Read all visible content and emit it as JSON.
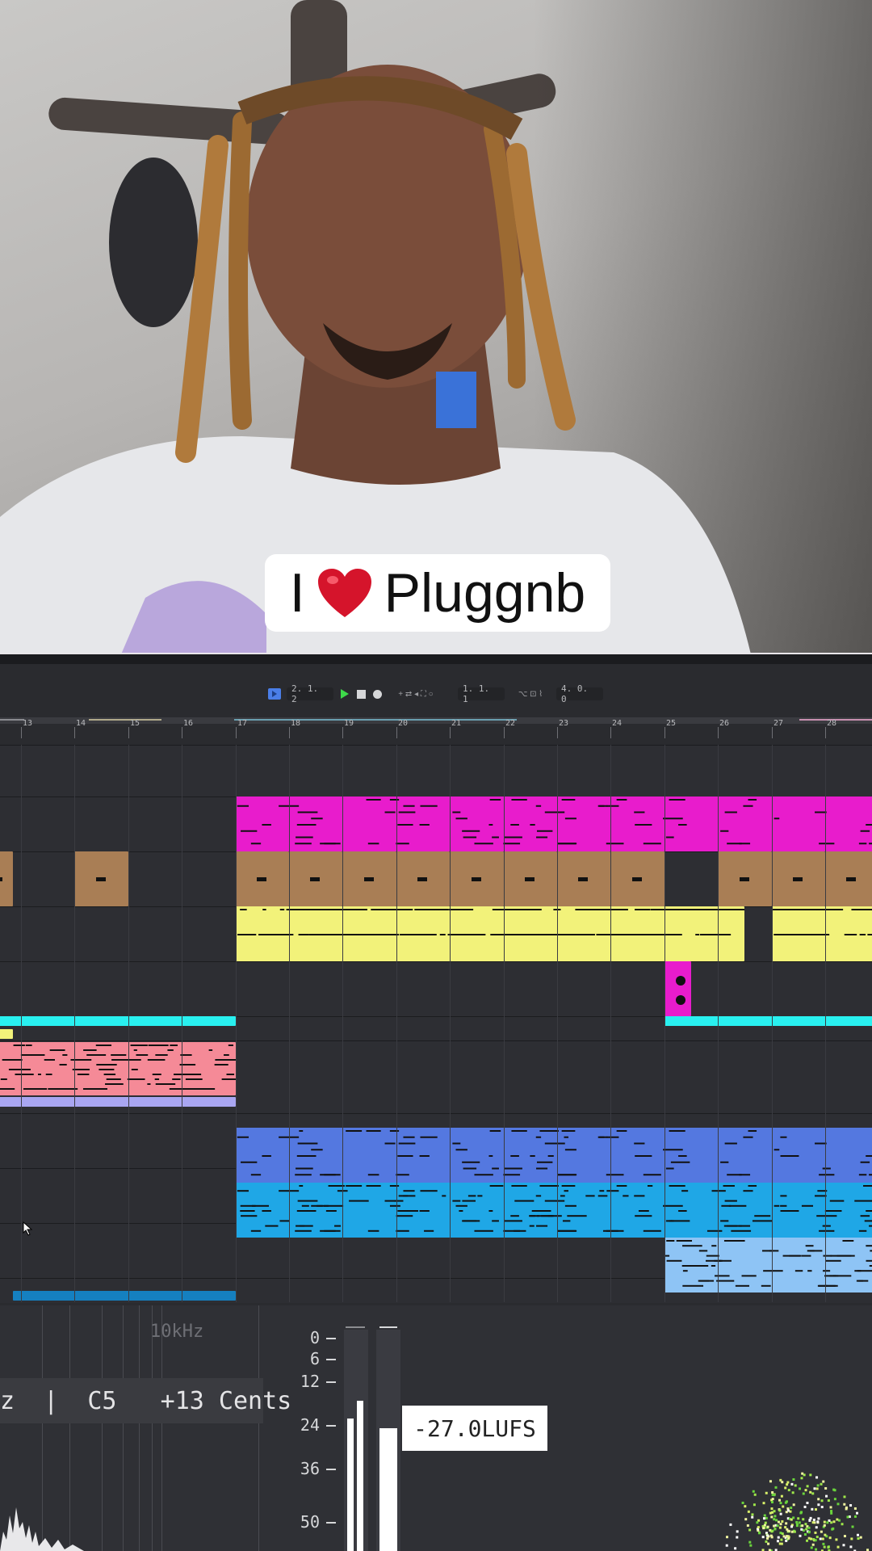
{
  "caption": {
    "text_before": "I",
    "heart_icon": "red-heart",
    "text_after": "Pluggnb"
  },
  "transport": {
    "position": "2. 1. 2",
    "loop_start": "1. 1. 1",
    "loop_length": "4. 0. 0"
  },
  "ruler": {
    "bars": [
      "13",
      "14",
      "15",
      "16",
      "17",
      "18",
      "19",
      "20",
      "21",
      "22",
      "23",
      "24",
      "25",
      "26",
      "27",
      "28"
    ]
  },
  "tracks": [
    {
      "name": "track-1-pink",
      "color": "#e81ccc"
    },
    {
      "name": "track-2-brown",
      "color": "#a97e55"
    },
    {
      "name": "track-3-yellow",
      "color": "#f2f27a"
    },
    {
      "name": "track-4-magenta",
      "color": "#e81ccc"
    },
    {
      "name": "track-5-cyan",
      "color": "#29f0f0"
    },
    {
      "name": "track-6-salmon",
      "color": "#f58a97"
    },
    {
      "name": "track-7-blue",
      "color": "#5478e0"
    },
    {
      "name": "track-8-sky",
      "color": "#1fa7e6"
    },
    {
      "name": "track-9-lightblue",
      "color": "#8ec4f5"
    }
  ],
  "analyzer": {
    "freq_label": "10kHz",
    "pitch_readout": "z  |  C5   +13 Cents",
    "db_scale": [
      "0",
      "6",
      "12",
      "24",
      "36",
      "50"
    ],
    "lufs": "-27.0LUFS"
  },
  "icons": [
    "play-icon",
    "stop-icon",
    "record-icon",
    "mouse-cursor-icon"
  ]
}
